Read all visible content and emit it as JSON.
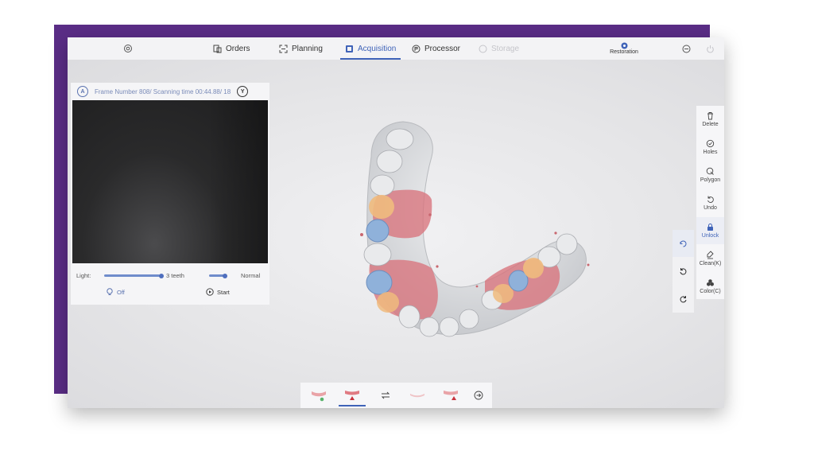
{
  "nav": {
    "settings_icon": "gear-icon",
    "tabs": [
      {
        "label": "Orders",
        "icon": "orders-icon",
        "state": "normal"
      },
      {
        "label": "Planning",
        "icon": "planning-icon",
        "state": "normal"
      },
      {
        "label": "Acquisition",
        "icon": "acquisition-icon",
        "state": "active"
      },
      {
        "label": "Processor",
        "icon": "processor-icon",
        "state": "normal"
      },
      {
        "label": "Storage",
        "icon": "storage-icon",
        "state": "disabled"
      }
    ],
    "restoration_label": "Restoration",
    "minimize_icon": "minimize-icon",
    "power_icon": "power-icon"
  },
  "camera": {
    "left_badge": "A",
    "right_badge": "Y",
    "status_text": "Frame Number 808/ Scanning time 00:44.88/ 18",
    "light_label": "Light:",
    "light_value": 1.0,
    "teeth_label": "3 teeth",
    "mode_value": 1.0,
    "mode_label": "Normal",
    "off_label": "Off",
    "start_label": "Start"
  },
  "right_toolbar": [
    {
      "label": "Delete",
      "icon": "trash-icon",
      "active": false
    },
    {
      "label": "Holes",
      "icon": "holes-icon",
      "active": false
    },
    {
      "label": "Polygon",
      "icon": "polygon-icon",
      "active": false
    },
    {
      "label": "Undo",
      "icon": "undo-icon",
      "active": false
    },
    {
      "label": "Unlock",
      "icon": "unlock-icon",
      "active": true
    },
    {
      "label": "Clean(K)",
      "icon": "clean-icon",
      "active": false
    },
    {
      "label": "Color(C)",
      "icon": "color-icon",
      "active": false
    }
  ],
  "mid_toolbar": [
    "rotate-lock-icon",
    "rotate-ccw-icon",
    "rotate-cw-icon"
  ],
  "bottom_toolbar": [
    {
      "icon": "upper-jaw-icon",
      "active": false
    },
    {
      "icon": "lower-jaw-icon",
      "active": true
    },
    {
      "icon": "swap-icon",
      "active": false
    },
    {
      "icon": "bite-icon",
      "active": false
    },
    {
      "icon": "lower-jaw-alt-icon",
      "active": false
    },
    {
      "icon": "next-arrow-icon",
      "active": false
    }
  ],
  "colors": {
    "accent": "#3f63b8",
    "brand_purple": "#5a2d86",
    "model_gray": "#e3e4e6",
    "margin_red": "#d9737c",
    "prep_orange": "#f0bb7e",
    "prep_blue": "#8fb1da"
  }
}
